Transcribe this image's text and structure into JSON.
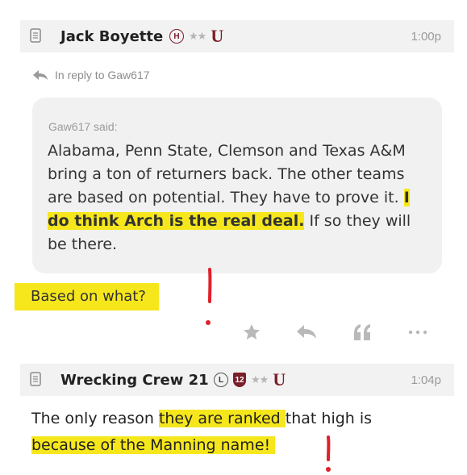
{
  "post1": {
    "author": "Jack Boyette",
    "badge_letter": "H",
    "stars": "★★",
    "team_logo": "U",
    "time": "1:00p",
    "reply_to": "In reply to Gaw617",
    "quote": {
      "author_line": "Gaw617 said:",
      "text_part1": "Alabama, Penn State, Clemson and Texas A&M bring a ton of returners back. The other teams are based on potential. They have to prove it. ",
      "text_highlight": "I do think Arch is the real deal.",
      "text_part2": " If so they will be there."
    },
    "reply_text": "Based on what?",
    "actions": [
      "star-icon",
      "reply-icon",
      "quote-icon",
      "more-icon"
    ]
  },
  "post2": {
    "author": "Wrecking Crew 21",
    "badge_letter": "L",
    "rank_badge": "12",
    "stars": "★★",
    "team_logo": "U",
    "time": "1:04p",
    "text_part1": "The only reason ",
    "text_highlight1": "they are ranked ",
    "text_part2": "that high is ",
    "text_highlight2": "because of the Manning name!"
  },
  "colors": {
    "highlight": "#f6e71c",
    "team_maroon": "#7a1f2a",
    "annotation_red": "#e0202a"
  }
}
